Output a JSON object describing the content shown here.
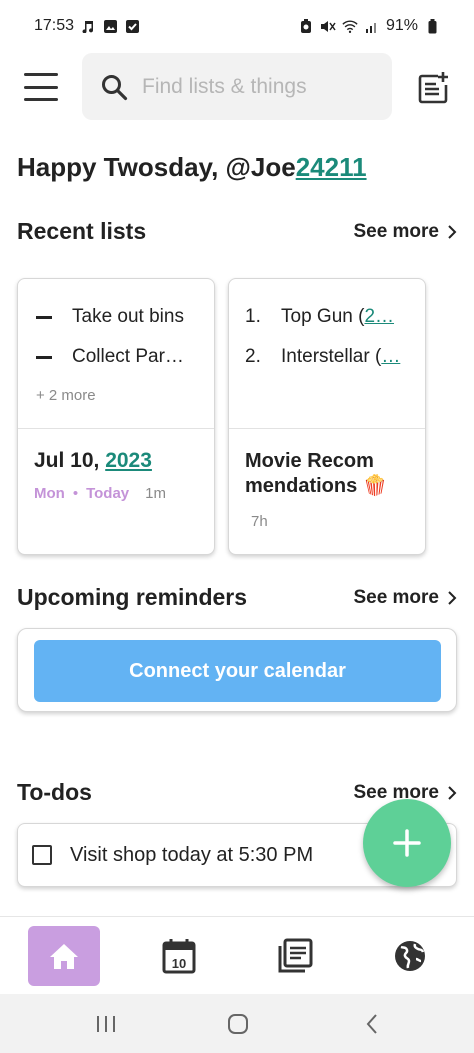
{
  "status_bar": {
    "time": "17:53",
    "battery": "91%",
    "left_icons": [
      "music-note-icon",
      "image-icon",
      "checkbox-icon"
    ],
    "right_icons": [
      "battery-saver-icon",
      "mute-icon",
      "wifi-icon",
      "signal-icon",
      "battery-icon"
    ]
  },
  "header": {
    "search_placeholder": "Find lists & things"
  },
  "greeting": {
    "prefix": "Happy Twosday, @Joe",
    "number": "24211"
  },
  "recent_lists": {
    "title": "Recent lists",
    "see_more": "See more",
    "cards": [
      {
        "items": [
          "Take out bins",
          "Collect Par…"
        ],
        "more": "+ 2 more",
        "date_prefix": "Jul 10, ",
        "date_year": "2023",
        "day": "Mon",
        "separator": "•",
        "day2": "Today",
        "age": "1m"
      },
      {
        "items": [
          {
            "num": "1.",
            "text": "Top Gun (",
            "link": "2…"
          },
          {
            "num": "2.",
            "text": "Interstellar (",
            "link": "…"
          }
        ],
        "title": "Movie Recom mendations 🍿",
        "age": "7h"
      }
    ]
  },
  "reminders": {
    "title": "Upcoming reminders",
    "see_more": "See more",
    "connect_label": "Connect your calendar",
    "button_color": "#63b3f3"
  },
  "todos": {
    "title": "To-dos",
    "see_more": "See more",
    "items": [
      "Visit shop today at 5:30 PM"
    ]
  },
  "fab": {
    "icon": "plus-icon",
    "color": "#5ed097"
  },
  "bottom_nav": {
    "items": [
      "home-icon",
      "calendar-icon",
      "lists-icon",
      "globe-icon"
    ],
    "calendar_day": "10",
    "active_color": "#c99ee0"
  },
  "colors": {
    "accent_teal": "#1b8a7a",
    "day_purple": "#c493d8"
  }
}
